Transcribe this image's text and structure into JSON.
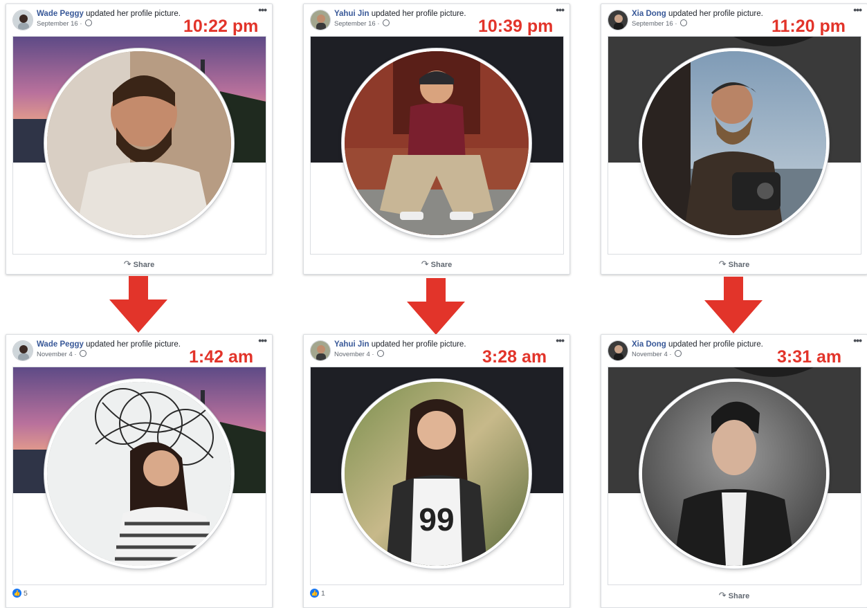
{
  "colors": {
    "accent_red": "#e2342a",
    "author_blue": "#385898",
    "like_blue": "#1877f2"
  },
  "action_text": "updated her profile picture.",
  "share_label": "Share",
  "more_icon": "•••",
  "columns": [
    {
      "author": "Wade Peggy",
      "before": {
        "date": "September 16 ·",
        "time": "10:22 pm",
        "footer": "share"
      },
      "after": {
        "date": "November 4 ·",
        "time": "1:42 am",
        "footer": "reactions",
        "reaction_count": "5"
      }
    },
    {
      "author": "Yahui Jin",
      "before": {
        "date": "September 16 ·",
        "time": "10:39 pm",
        "footer": "share"
      },
      "after": {
        "date": "November 4 ·",
        "time": "3:28 am",
        "footer": "reactions",
        "reaction_count": "1"
      }
    },
    {
      "author": "Xia Dong",
      "before": {
        "date": "September 16 ·",
        "time": "11:20 pm",
        "footer": "share"
      },
      "after": {
        "date": "November 4 ·",
        "time": "3:31 am",
        "footer": "share"
      }
    }
  ]
}
